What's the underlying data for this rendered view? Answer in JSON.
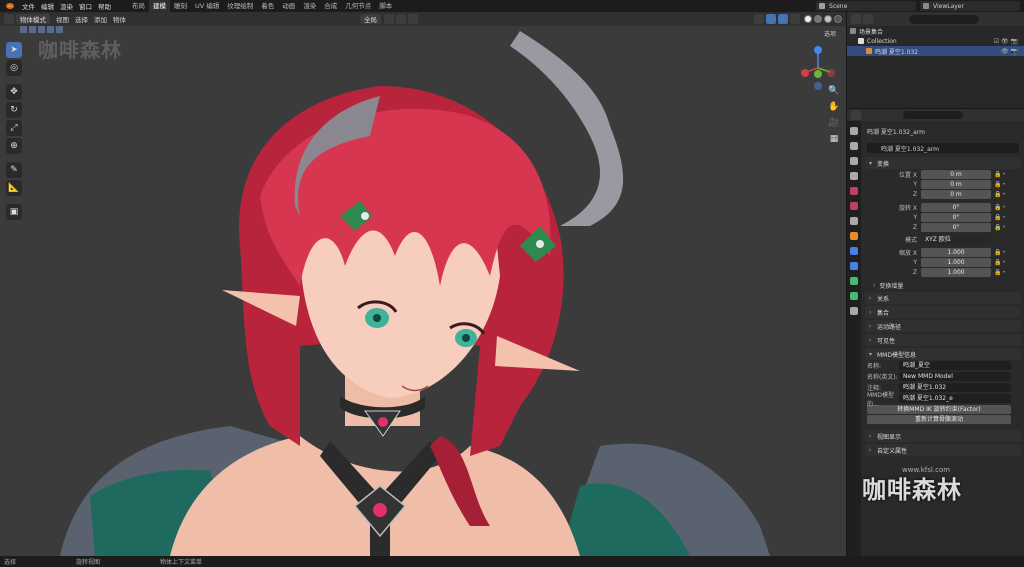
{
  "menu": {
    "items": [
      "文件",
      "编辑",
      "渲染",
      "窗口",
      "帮助"
    ]
  },
  "workspaces": {
    "tabs": [
      "布局",
      "建模",
      "雕刻",
      "UV 编辑",
      "纹理绘制",
      "着色",
      "动画",
      "渲染",
      "合成",
      "几何节点",
      "脚本"
    ],
    "active_index": 1
  },
  "scene": {
    "name": "Scene",
    "view_layer": "ViewLayer"
  },
  "viewport_header": {
    "mode": "物体模式",
    "menus": [
      "视图",
      "选择",
      "添加",
      "物体"
    ],
    "orientation": "全局",
    "options_label": "选项"
  },
  "watermark": {
    "top_left": "咖啡森林",
    "bottom_right": "咖啡森林",
    "url": "www.kfsl.com"
  },
  "toolbar": {
    "tools": [
      "select",
      "cursor",
      "move",
      "rotate",
      "scale",
      "transform",
      "annotate",
      "measure",
      "add-cube"
    ]
  },
  "outliner": {
    "root": "场景集合",
    "collection": "Collection",
    "object": "鸣潮 夏空1.032"
  },
  "properties": {
    "object_name": "鸣潮 夏空1.032_arm",
    "data_name": "鸣潮 夏空1.032_arm",
    "transform_panel": "变换",
    "location_label": "位置 X",
    "location": [
      {
        "axis": "位置 X",
        "value": "0 m"
      },
      {
        "axis": "Y",
        "value": "0 m"
      },
      {
        "axis": "Z",
        "value": "0 m"
      }
    ],
    "rotation": [
      {
        "axis": "旋转 X",
        "value": "0°"
      },
      {
        "axis": "Y",
        "value": "0°"
      },
      {
        "axis": "Z",
        "value": "0°"
      }
    ],
    "mode_label": "模式",
    "mode_value": "XYZ 欧拉",
    "scale": [
      {
        "axis": "缩放 X",
        "value": "1.000"
      },
      {
        "axis": "Y",
        "value": "1.000"
      },
      {
        "axis": "Z",
        "value": "1.000"
      }
    ],
    "delta_transform": "变换增量",
    "panels": [
      "关系",
      "集合",
      "运动路径",
      "可见性"
    ],
    "mmd_panel": "MMD模型信息",
    "mmd": {
      "name_label": "名称:",
      "name_value": "鸣潮_夏空",
      "name_en_label": "名称(英文):",
      "name_en_value": "New MMD Model",
      "comment_label": "注释:",
      "comment_value": "鸣潮 夏空1.032",
      "comment_en_label": "MMD模型的...",
      "comment_en_value": "鸣潮 夏空1.032_e",
      "btn_ik": "转换MMD IK 旋转约束(Factor)",
      "btn_recalc": "重新计算骨骼滚动"
    },
    "bottom_panels": [
      "视图显示",
      "自定义属性"
    ]
  },
  "statusbar": {
    "items": [
      "选择",
      "旋转视图",
      "物体上下文菜单"
    ]
  }
}
